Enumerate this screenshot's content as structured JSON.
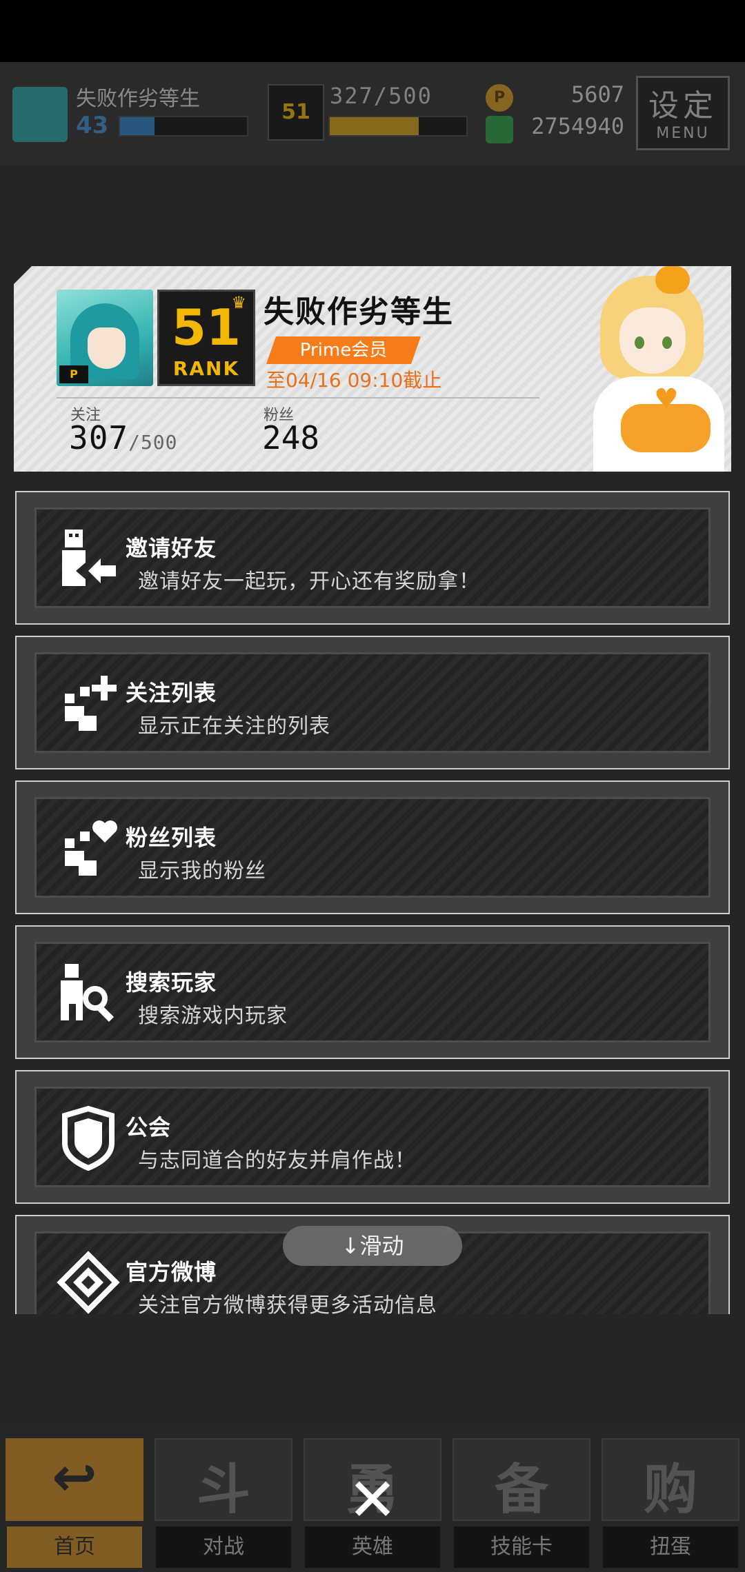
{
  "hud": {
    "player_name": "失败作劣等生",
    "level": "43",
    "level_progress": 0.27,
    "rank_label": "51",
    "rank_sub": "RANK",
    "rank_points": "327/500",
    "rank_progress": 0.65,
    "coins": "5607",
    "gems": "2754940",
    "menu_label": "设定",
    "menu_sub": "MENU",
    "coin_letter": "P"
  },
  "profile": {
    "name": "失败作劣等生",
    "rank_number": "51",
    "rank_label": "RANK",
    "avatar_tag": "P",
    "membership": "Prime会员",
    "expiry": "至04/16 09:10截止",
    "follow_label": "关注",
    "follow_value": "307",
    "follow_max": "/500",
    "fans_label": "粉丝",
    "fans_value": "248"
  },
  "items": [
    {
      "title": "邀请好友",
      "desc": "邀请好友一起玩，开心还有奖励拿！",
      "icon": "invite-friend-icon"
    },
    {
      "title": "关注列表",
      "desc": "显示正在关注的列表",
      "icon": "follow-list-icon"
    },
    {
      "title": "粉丝列表",
      "desc": "显示我的粉丝",
      "icon": "fans-list-icon"
    },
    {
      "title": "搜索玩家",
      "desc": "搜索游戏内玩家",
      "icon": "search-player-icon"
    },
    {
      "title": "公会",
      "desc": "与志同道合的好友并肩作战！",
      "icon": "guild-shield-icon"
    },
    {
      "title": "官方微博",
      "desc": "关注官方微博获得更多活动信息",
      "icon": "weibo-icon"
    }
  ],
  "scroll_hint": "↓滑动",
  "nav": [
    {
      "label": "首页",
      "glyph": "↩"
    },
    {
      "label": "对战",
      "glyph": "斗"
    },
    {
      "label": "英雄",
      "glyph": "勇"
    },
    {
      "label": "技能卡",
      "glyph": "备"
    },
    {
      "label": "扭蛋",
      "glyph": "购"
    }
  ],
  "close_symbol": "✕"
}
